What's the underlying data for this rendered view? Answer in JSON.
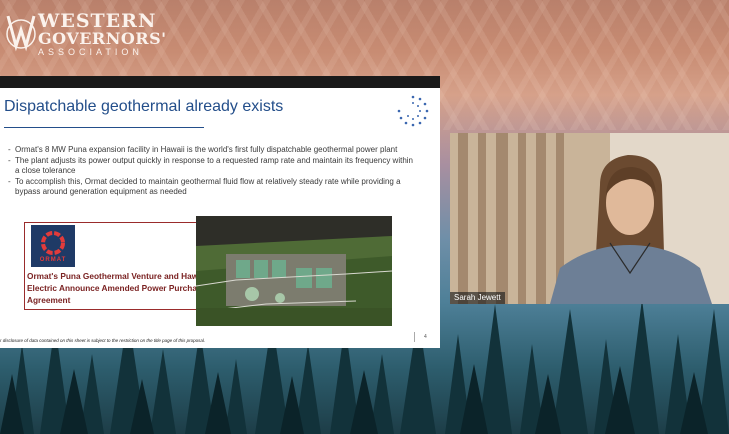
{
  "brand": {
    "line1": "WESTERN",
    "line2": "GOVERNORS'",
    "line3": "ASSOCIATION"
  },
  "slide": {
    "title": "Dispatchable geothermal already exists",
    "bullets": [
      "Ormat's 8 MW Puna expansion facility in Hawaii is the world's first fully dispatchable geothermal power plant",
      "The plant adjusts its power output quickly in response to a requested ramp rate and maintain its frequency within a close tolerance",
      "To accomplish this, Ormat decided to maintain geothermal fluid flow at relatively steady rate while providing a bypass around generation equipment as needed"
    ],
    "card": {
      "logo_text": "ORMAT",
      "headline": "Ormat's Puna Geothermal Venture and Hawaiian Electric Announce Amended Power Purchase Agreement"
    },
    "disclaimer": "r disclosure of data contained on this sheet is subject to the restriction on the title page of this proposal.",
    "page_number": "4"
  },
  "participant": {
    "name": "Sarah Jewett"
  },
  "colors": {
    "title_blue": "#234e8a",
    "card_red": "#9a2c2c",
    "ormat_navy": "#1f3a66"
  }
}
